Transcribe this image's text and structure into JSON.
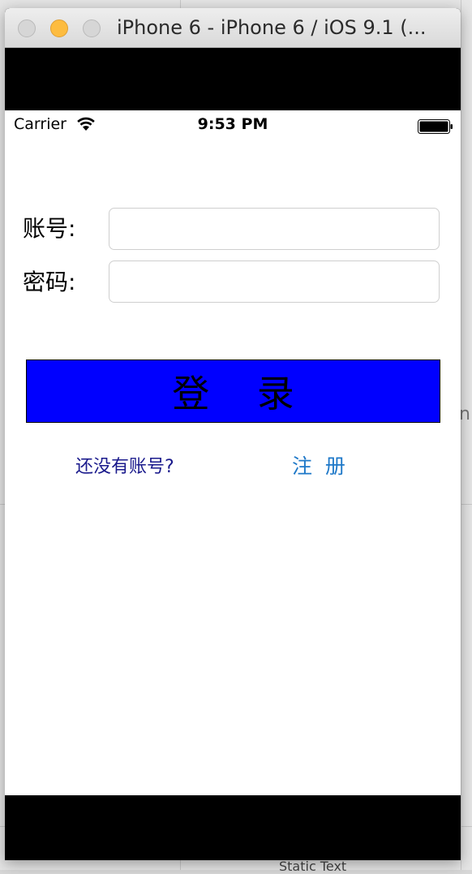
{
  "window": {
    "title": "iPhone 6 - iPhone 6 / iOS 9.1 (..."
  },
  "status_bar": {
    "carrier": "Carrier",
    "time": "9:53 PM",
    "wifi_icon": "wifi-icon",
    "battery_icon": "battery-icon"
  },
  "form": {
    "account_label": "账号:",
    "account_value": "",
    "password_label": "密码:",
    "password_value": "",
    "login_button_label": "登    录",
    "no_account_text": "还没有账号?",
    "register_label": "注  册"
  },
  "background": {
    "peek_text": "Static Text",
    "peek_letter": "n"
  },
  "colors": {
    "login_button_bg": "#0000ff",
    "register_link": "#1e78c8",
    "no_account_text": "#1a1a8c",
    "minimize_button": "#fdbc40"
  }
}
